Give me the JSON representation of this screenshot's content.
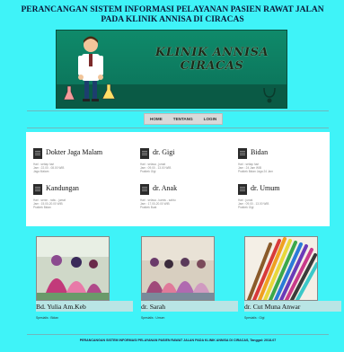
{
  "header": {
    "title_line1": "PERANCANGAN SISTEM INFORMASI PELAYANAN PASIEN RAWAT JALAN",
    "title_line2": "PADA KLINIK ANNISA DI CIRACAS"
  },
  "banner": {
    "clinic_name_line1": "KLINIK ANNISA",
    "clinic_name_line2": "CIRACAS"
  },
  "nav": {
    "items": [
      "HOME",
      "TENTANG",
      "LOGIN"
    ]
  },
  "services": [
    {
      "name": "Dokter Jaga Malam",
      "l1": "Hari : setiap hari",
      "l2": "Jam : 22.00 - 08.00 WIB",
      "l3": "Jaga Malam"
    },
    {
      "name": "dr. Gigi",
      "l1": "Hari : selasa , jumat",
      "l2": "Jam : 09.00 - 13.00 WIB",
      "l3": "Praktek Gigi"
    },
    {
      "name": "Bidan",
      "l1": "Hari : setiap hari",
      "l2": "Jam : 24 Jam WIB",
      "l3": "Praktek Bidan Jaga 24 Jam"
    },
    {
      "name": "Kandungan",
      "l1": "Hari : senin - rabu - jumat",
      "l2": "Jam : 15.00-20.00 WIB",
      "l3": "Praktek Bidan"
    },
    {
      "name": "dr. Anak",
      "l1": "Hari : selasa - kamis - sabtu",
      "l2": "Jam : 17.00-20.00 WIB",
      "l3": "Praktek Buat"
    },
    {
      "name": "dr. Umum",
      "l1": "Hari : jumat",
      "l2": "Jam : 09.00 - 13.00 WIB",
      "l3": "Praktek Gigi"
    }
  ],
  "staff": [
    {
      "name": "Bd. Yulia Am.Keb",
      "spec": "Spesialis : Bidan"
    },
    {
      "name": "dr. Sarah",
      "spec": "Spesialis : Umum"
    },
    {
      "name": "dr. Cut Muna Anwar",
      "spec": "Spesialis : Gigi"
    }
  ],
  "footer": {
    "text": "PERANCANGAN SISTEM INFORMASI PELAYANAN PASIEN RAWAT JALAN PADA KLINIK ANNISA DI CIRACAS, Tanggal: 2018-07"
  },
  "colors": {
    "background": "#3ff3f8",
    "banner": "#0f8a6a",
    "panel": "#ffffff"
  }
}
